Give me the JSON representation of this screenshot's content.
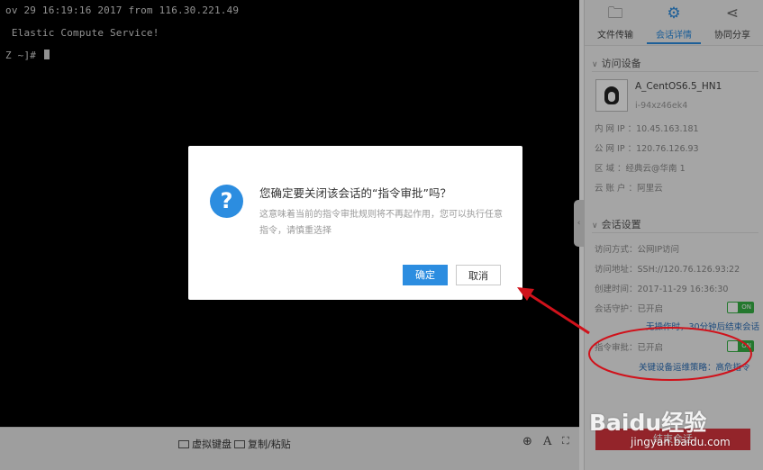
{
  "terminal": {
    "lines": [
      "ov 29 16:19:16 2017 from 116.30.221.49",
      " Elastic Compute Service!",
      "Z ~]# "
    ]
  },
  "bottombar": {
    "virtual_keyboard": "虚拟键盘",
    "copy_paste": "复制/粘贴",
    "font_tool": "A"
  },
  "panel": {
    "tabs": [
      {
        "label": "文件传输",
        "icon": "file-transfer-icon"
      },
      {
        "label": "会话详情",
        "icon": "gear-icon"
      },
      {
        "label": "协同分享",
        "icon": "share-icon"
      }
    ],
    "device_section_title": "访问设备",
    "device": {
      "name": "A_CentOS6.5_HN1",
      "id": "i-94xz46ek4",
      "intranet_ip_label": "内 网 IP ：",
      "intranet_ip": "10.45.163.181",
      "public_ip_label": "公 网 IP ：",
      "public_ip": "120.76.126.93",
      "region_label": "区    域 ：",
      "region": "经典云@华南 1",
      "account_label": "云 账 户 ：",
      "account": "阿里云"
    },
    "session_section_title": "会话设置",
    "session": {
      "method_label": "访问方式：",
      "method": "公网IP访问",
      "address_label": "访问地址：",
      "address": "SSH://120.76.126.93:22",
      "created_label": "创建时间：",
      "created": "2017-11-29 16:36:30",
      "guard_label": "会话守护：",
      "guard": "已开启",
      "guard_note": "无操作时，30分钟后结束会话",
      "approval_label": "指令审批：",
      "approval": "已开启",
      "approval_note": "关键设备运维策略：高危指令",
      "toggle_on": "ON"
    },
    "end_button": "结束会话"
  },
  "dialog": {
    "title": "您确定要关闭该会话的“指令审批”吗？",
    "description": "这意味着当前的指令审批规则将不再起作用，您可以执行任意指令，请慎重选择",
    "ok": "确定",
    "cancel": "取消"
  },
  "watermark": {
    "brand": "Baidu经验",
    "url": "jingyan.baidu.com"
  },
  "colors": {
    "accent": "#2c8de0",
    "toggle_on": "#35b145",
    "annotation": "#d0121b"
  }
}
